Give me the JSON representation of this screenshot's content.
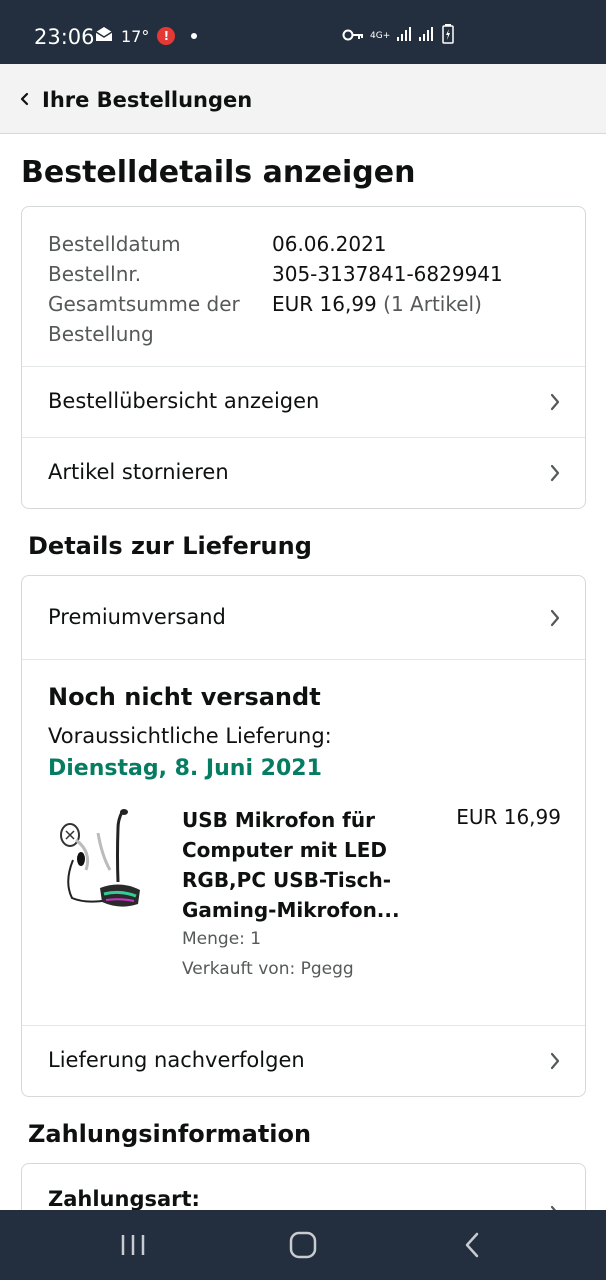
{
  "status_bar": {
    "time": "23:06",
    "temperature": "17°",
    "alert": "!",
    "network": "4G+",
    "icons": [
      "mail-icon",
      "alert-icon",
      "key-icon",
      "signal-icon",
      "battery-icon"
    ]
  },
  "header": {
    "back_label": "Ihre Bestellungen"
  },
  "page_title": "Bestelldetails anzeigen",
  "order_summary": {
    "rows": [
      {
        "label": "Bestelldatum",
        "value": "06.06.2021"
      },
      {
        "label": "Bestellnr.",
        "value": "305-3137841-6829941"
      },
      {
        "label": "Gesamtsumme der Bestellung",
        "value": "EUR 16,99",
        "extra": "(1 Artikel)"
      }
    ],
    "links": [
      "Bestellübersicht anzeigen",
      "Artikel stornieren"
    ]
  },
  "delivery": {
    "section_title": "Details zur Lieferung",
    "shipping_method": "Premiumversand",
    "status": "Noch nicht versandt",
    "eta_label": "Voraussichtliche Lieferung:",
    "eta_date": "Dienstag, 8. Juni 2021",
    "item": {
      "title": "USB Mikrofon für Computer mit LED RGB,PC USB-Tisch-Gaming-Mikrofon...",
      "price": "EUR 16,99",
      "quantity": "Menge: 1",
      "seller": "Verkauft von: Pgegg"
    },
    "track_label": "Lieferung nachverfolgen"
  },
  "payment": {
    "section_title": "Zahlungsinformation",
    "method_label": "Zahlungsart:"
  },
  "colors": {
    "status_bar": "#232f3e",
    "delivery_green": "#067d62",
    "border": "#d5d9d9"
  }
}
